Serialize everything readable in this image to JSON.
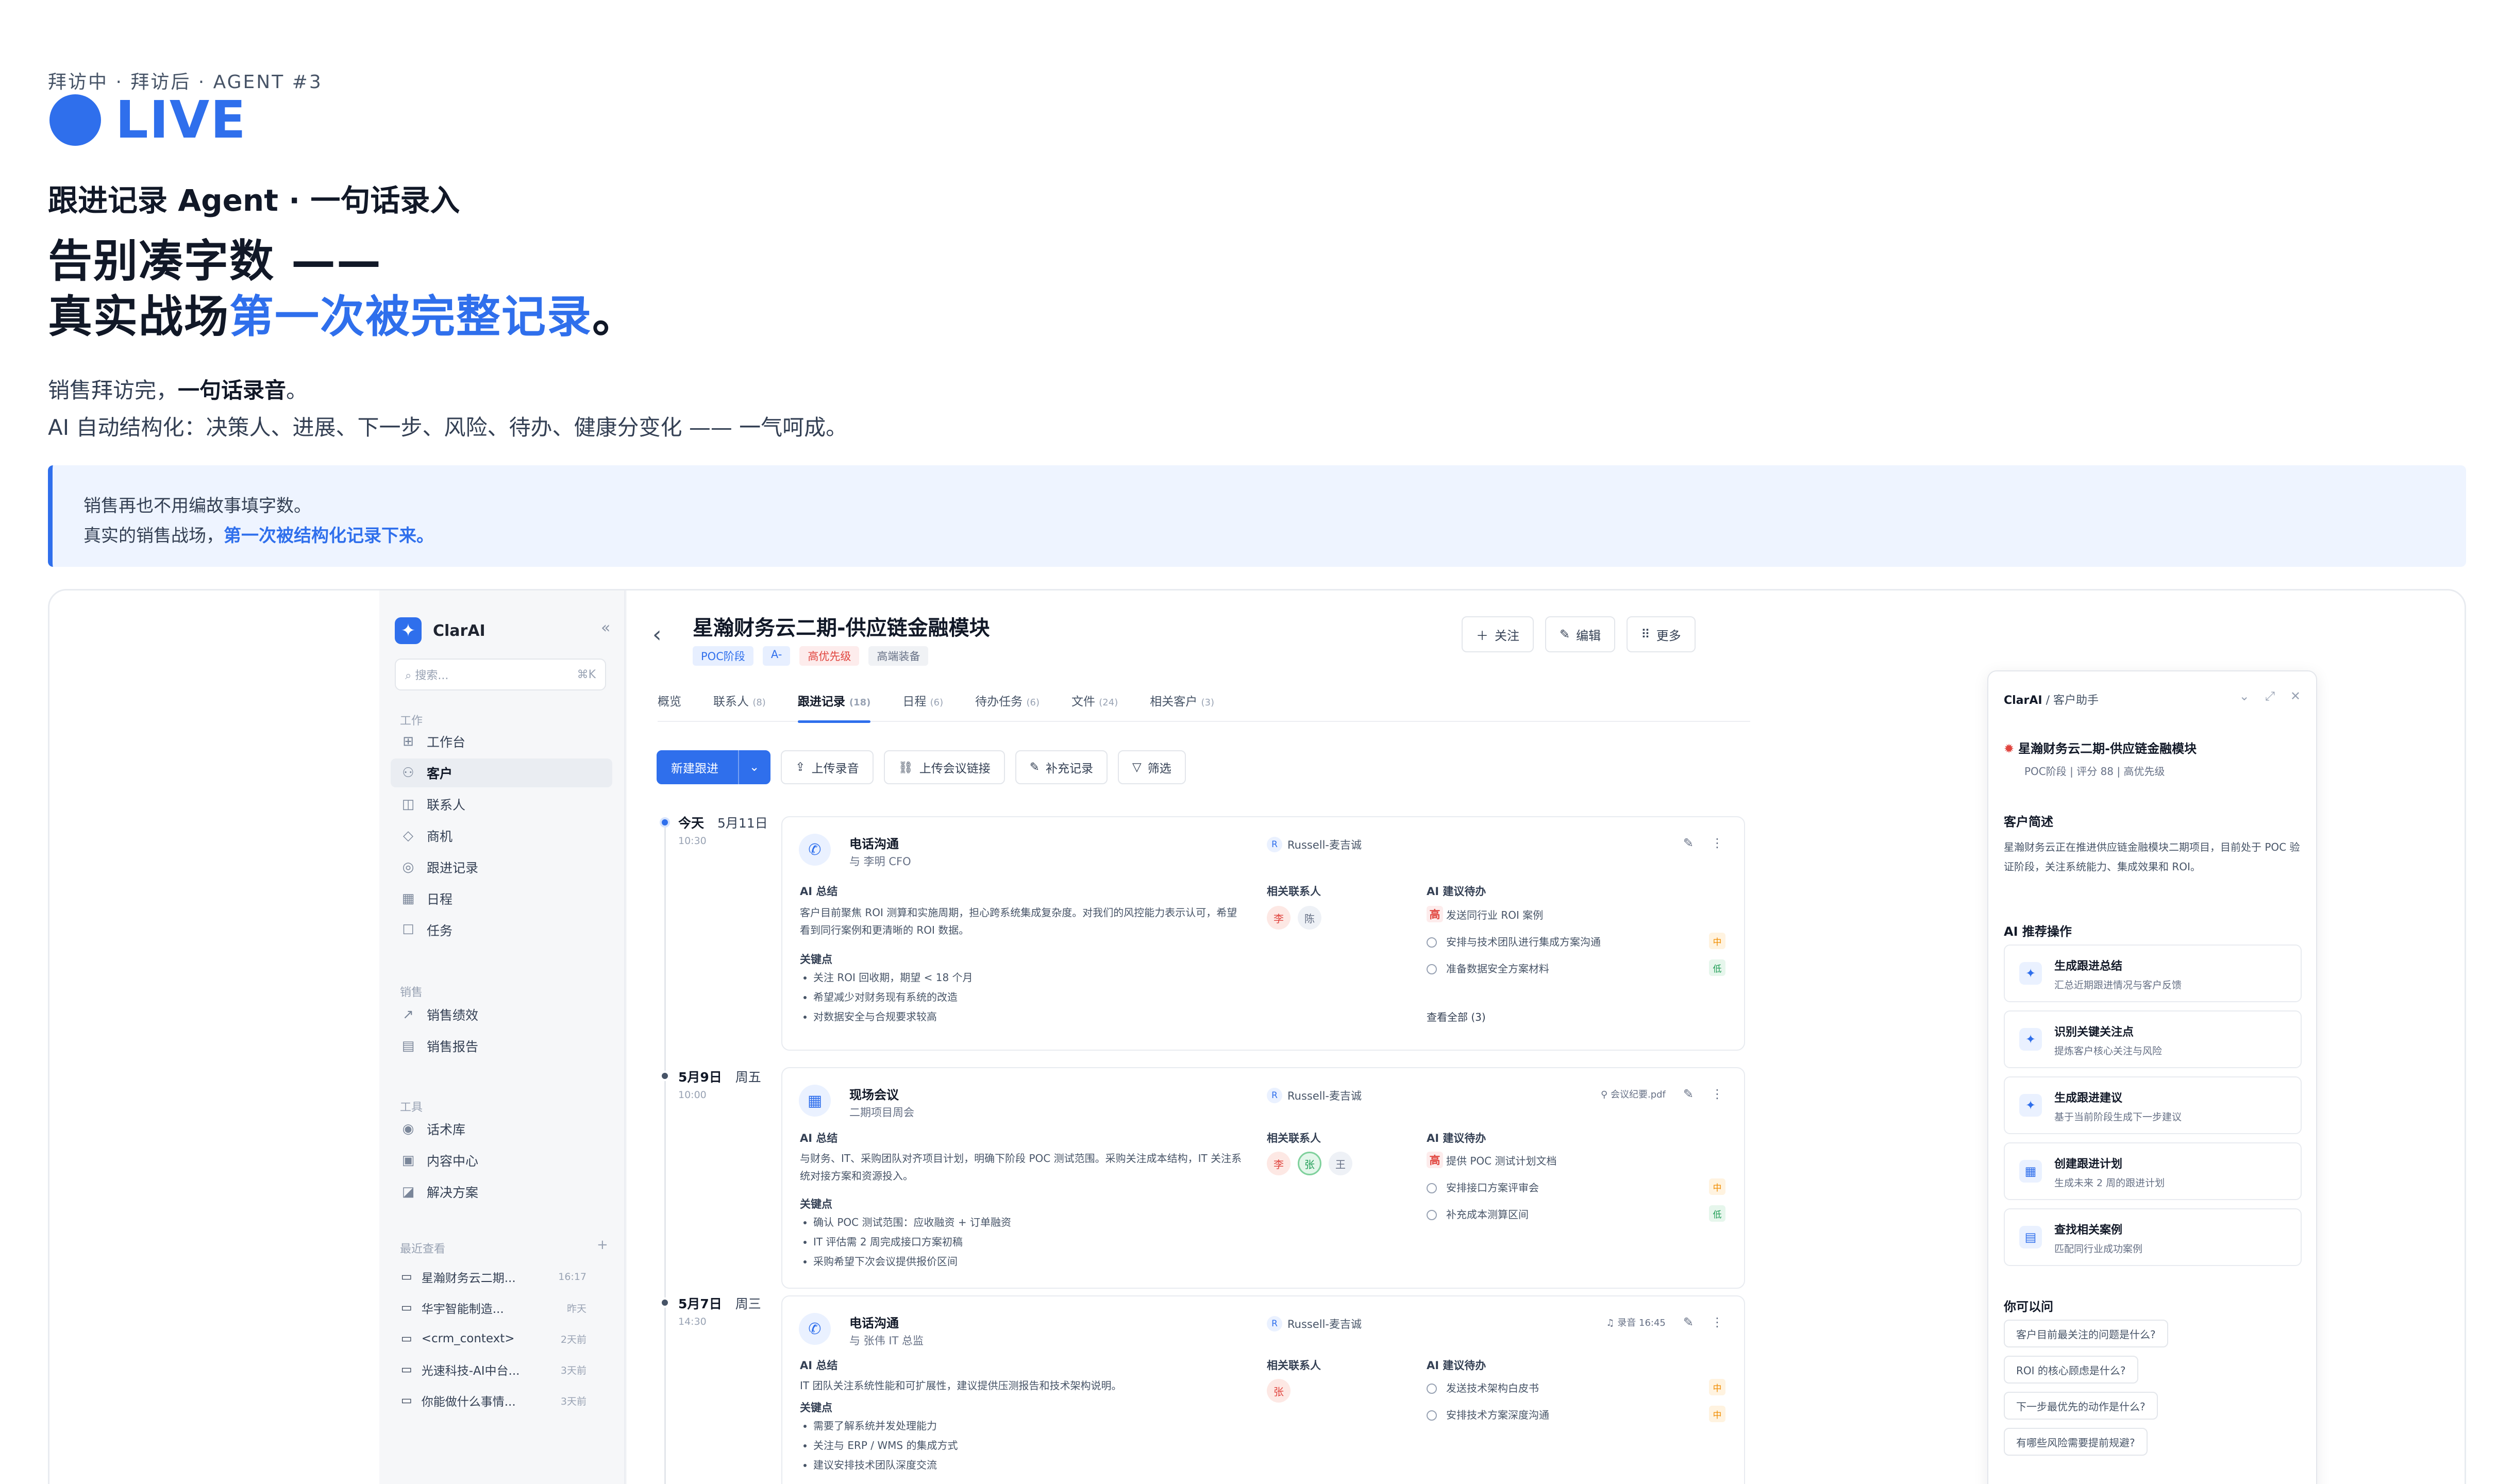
{
  "hero": {
    "kicker": "拜访中 · 拜访后 · AGENT #3",
    "live": "LIVE",
    "subtitle": "跟进记录 Agent · 一句话录入",
    "headline_1": "告别凑字数 ——",
    "headline_2a": "真实战场",
    "headline_2b": "第一次被完整记录",
    "headline_2c": "。",
    "desc_1a": "销售拜访完，",
    "desc_1b": "一句话录音",
    "desc_1c": "。",
    "desc_2": "AI 自动结构化：决策人、进展、下一步、风险、待办、健康分变化 —— 一气呵成。",
    "callout_1": "销售再也不用编故事填字数。",
    "callout_2a": "真实的销售战场，",
    "callout_2b": "第一次被结构化记录下来。"
  },
  "sidebar": {
    "brand": "ClarAI",
    "search_placeholder": "搜索...",
    "search_shortcut": "⌘K",
    "sections": [
      "工作",
      "销售",
      "工具",
      "最近查看"
    ],
    "work_items": [
      "工作台",
      "客户",
      "联系人",
      "商机",
      "跟进记录",
      "日程",
      "任务"
    ],
    "sales_items": [
      "销售绩效",
      "销售报告"
    ],
    "tool_items": [
      "话术库",
      "内容中心",
      "解决方案"
    ],
    "recent": [
      {
        "name": "星瀚财务云二期...",
        "time": "16:17"
      },
      {
        "name": "华宇智能制造...",
        "time": "昨天"
      },
      {
        "name": "<crm_context>",
        "time": "2天前"
      },
      {
        "name": "光速科技-AI中台...",
        "time": "3天前"
      },
      {
        "name": "你能做什么事情...",
        "time": "3天前"
      }
    ]
  },
  "detail": {
    "title": "星瀚财务云二期-供应链金融模块",
    "tags": [
      "POC阶段",
      "A-",
      "高优先级",
      "高端装备"
    ],
    "buttons": [
      "关注",
      "编辑",
      "更多"
    ],
    "tabs": [
      {
        "label": "概览",
        "count": ""
      },
      {
        "label": "联系人",
        "count": "(8)"
      },
      {
        "label": "跟进记录",
        "count": "(18)"
      },
      {
        "label": "日程",
        "count": "(6)"
      },
      {
        "label": "待办任务",
        "count": "(6)"
      },
      {
        "label": "文件",
        "count": "(24)"
      },
      {
        "label": "相关客户",
        "count": "(3)"
      }
    ],
    "toolbar": [
      "新建跟进",
      "上传录音",
      "上传会议链接",
      "补充记录",
      "筛选"
    ]
  },
  "records": [
    {
      "date": "今天",
      "day": "5月11日",
      "time": "10:30",
      "type": "电话沟通",
      "with": "与 李明 CFO",
      "owner": "Russell-麦吉诚",
      "attachment": "",
      "ai_summary_label": "AI 总结",
      "summary": "客户目前聚焦 ROI 测算和实施周期，担心跨系统集成复杂度。对我们的风控能力表示认可，希望看到同行案例和更清晰的 ROI 数据。",
      "keypoints_label": "关键点",
      "keypoints": [
        "关注 ROI 回收期，期望 < 18 个月",
        "希望减少对财务现有系统的改造",
        "对数据安全与合规要求较高"
      ],
      "contacts_label": "相关联系人",
      "contacts": [
        "李",
        "陈"
      ],
      "todos_label": "AI 建议待办",
      "todos": [
        {
          "text": "发送同行业 ROI 案例",
          "p": "高"
        },
        {
          "text": "安排与技术团队进行集成方案沟通",
          "p": "中"
        },
        {
          "text": "准备数据安全方案材料",
          "p": "低"
        }
      ],
      "more": "查看全部 (3)"
    },
    {
      "date": "5月9日",
      "day": "周五",
      "time": "10:00",
      "type": "现场会议",
      "with": "二期项目周会",
      "owner": "Russell-麦吉诚",
      "attachment": "会议纪要.pdf",
      "ai_summary_label": "AI 总结",
      "summary": "与财务、IT、采购团队对齐项目计划，明确下阶段 POC 测试范围。采购关注成本结构，IT 关注系统对接方案和资源投入。",
      "keypoints_label": "关键点",
      "keypoints": [
        "确认 POC 测试范围：应收融资 + 订单融资",
        "IT 评估需 2 周完成接口方案初稿",
        "采购希望下次会议提供报价区间"
      ],
      "contacts_label": "相关联系人",
      "contacts": [
        "李",
        "张",
        "王"
      ],
      "todos_label": "AI 建议待办",
      "todos": [
        {
          "text": "提供 POC 测试计划文档",
          "p": "高"
        },
        {
          "text": "安排接口方案评审会",
          "p": "中"
        },
        {
          "text": "补充成本测算区间",
          "p": "低"
        }
      ],
      "more": ""
    },
    {
      "date": "5月7日",
      "day": "周三",
      "time": "14:30",
      "type": "电话沟通",
      "with": "与 张伟 IT 总监",
      "owner": "Russell-麦吉诚",
      "attachment": "录音 16:45",
      "ai_summary_label": "AI 总结",
      "summary": "IT 团队关注系统性能和可扩展性，建议提供压测报告和技术架构说明。",
      "keypoints_label": "关键点",
      "keypoints": [
        "需要了解系统并发处理能力",
        "关注与 ERP / WMS 的集成方式",
        "建议安排技术团队深度交流"
      ],
      "contacts_label": "相关联系人",
      "contacts": [
        "张"
      ],
      "todos_label": "AI 建议待办",
      "todos": [
        {
          "text": "发送技术架构白皮书",
          "p": "中"
        },
        {
          "text": "安排技术方案深度沟通",
          "p": "中"
        }
      ],
      "more": ""
    }
  ],
  "assistant": {
    "breadcrumb_a": "ClarAI",
    "breadcrumb_b": "客户助手",
    "customer": "星瀚财务云二期-供应链金融模块",
    "meta": "POC阶段 | 评分 88 | 高优先级",
    "summary_label": "客户简述",
    "summary": "星瀚财务云正在推进供应链金融模块二期项目，目前处于 POC 验证阶段，关注系统能力、集成效果和 ROI。",
    "actions_label": "AI 推荐操作",
    "actions": [
      {
        "title": "生成跟进总结",
        "sub": "汇总近期跟进情况与客户反馈"
      },
      {
        "title": "识别关键关注点",
        "sub": "提炼客户核心关注与风险"
      },
      {
        "title": "生成跟进建议",
        "sub": "基于当前阶段生成下一步建议"
      },
      {
        "title": "创建跟进计划",
        "sub": "生成未来 2 周的跟进计划"
      },
      {
        "title": "查找相关案例",
        "sub": "匹配同行业成功案例"
      }
    ],
    "ask_label": "你可以问",
    "questions": [
      "客户目前最关注的问题是什么?",
      "ROI 的核心顾虑是什么?",
      "下一步最优先的动作是什么?",
      "有哪些风险需要提前规避?"
    ]
  }
}
